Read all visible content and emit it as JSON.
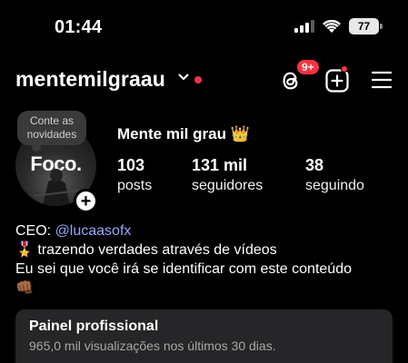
{
  "status_bar": {
    "time": "01:44",
    "battery": "77"
  },
  "header": {
    "username": "mentemilgraau",
    "notifications_badge": "9+"
  },
  "profile": {
    "note": "Conte as novidades",
    "avatar_text": "Foco.",
    "display_name": "Mente mil grau 👑",
    "stats": [
      {
        "value": "103",
        "label": "posts"
      },
      {
        "value": "131 mil",
        "label": "seguidores"
      },
      {
        "value": "38",
        "label": "seguindo"
      }
    ],
    "bio": {
      "ceo_prefix": "CEO: ",
      "ceo_mention": "@lucaasofx",
      "line2": "🎖️ trazendo verdades através de vídeos",
      "line3": "Eu sei que você irá se identificar com este conteúdo",
      "line4": "👊🏾"
    }
  },
  "professional_panel": {
    "title": "Painel profissional",
    "subtitle": "965,0 mil visualizações nos últimos 30 dias."
  },
  "colors": {
    "background": "#000000",
    "accent_red": "#ff3040",
    "mention_blue": "#8fa8ff",
    "panel_bg": "#262628"
  }
}
